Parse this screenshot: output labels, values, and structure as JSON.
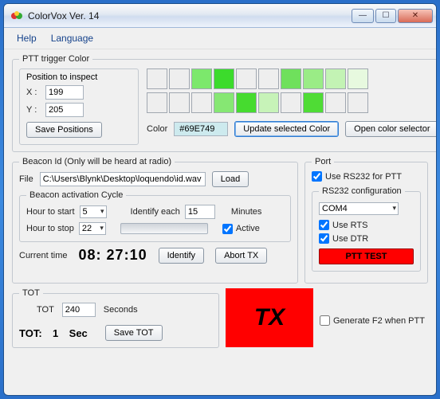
{
  "window": {
    "title": "ColorVox  Ver. 14"
  },
  "menu": {
    "help": "Help",
    "language": "Language"
  },
  "ptt": {
    "legend": "PTT trigger Color",
    "position_header": "Position to inspect",
    "x_label": "X :",
    "x_value": "199",
    "y_label": "Y :",
    "y_value": "205",
    "save_btn": "Save Positions",
    "color_label": "Color",
    "hex": "#69E749",
    "update_btn": "Update selected Color",
    "open_btn": "Open color selector",
    "row1": [
      "#eeeeee",
      "#eeeeee",
      "#7ce86c",
      "#3cdb2c",
      "#eeeeee",
      "#eeeeee",
      "#6fe05c",
      "#9aec86",
      "#c3f3b4",
      "#e7f9df"
    ],
    "row2": [
      "#eeeeee",
      "#eeeeee",
      "#eeeeee",
      "#86e773",
      "#46db2f",
      "#c7f3b8",
      "#eeeeee",
      "#4fdc35",
      "#eeeeee",
      "#eeeeee"
    ]
  },
  "beacon": {
    "legend": "Beacon  Id (Only will  be heard at radio)",
    "file_label": "File",
    "file_value": "C:\\Users\\Blynk\\Desktop\\loquendo\\id.wav",
    "load_btn": "Load",
    "cycle_legend": "Beacon activation Cycle",
    "start_label": "Hour to start",
    "start_value": "5",
    "stop_label": "Hour to stop",
    "stop_value": "22",
    "identify_each_label": "Identify each",
    "identify_each_value": "15",
    "minutes": "Minutes",
    "active_label": "Active",
    "current_label": "Current time",
    "current_time": "08: 27:10",
    "identify_btn": "Identify",
    "abort_btn": "Abort TX"
  },
  "port": {
    "legend": "Port",
    "use_rs232": "Use RS232 for PTT",
    "rs232_legend": "RS232 configuration",
    "com_value": "COM4",
    "use_rts": "Use RTS",
    "use_dtr": "Use DTR",
    "ptt_test": "PTT TEST",
    "gen_f2": "Generate F2 when PTT"
  },
  "tot": {
    "legend": "TOT",
    "tot_label": "TOT",
    "tot_value": "240",
    "seconds": "Seconds",
    "count_label": "TOT:",
    "count_value": "1",
    "count_unit": "Sec",
    "save_btn": "Save TOT",
    "tx": "TX"
  }
}
